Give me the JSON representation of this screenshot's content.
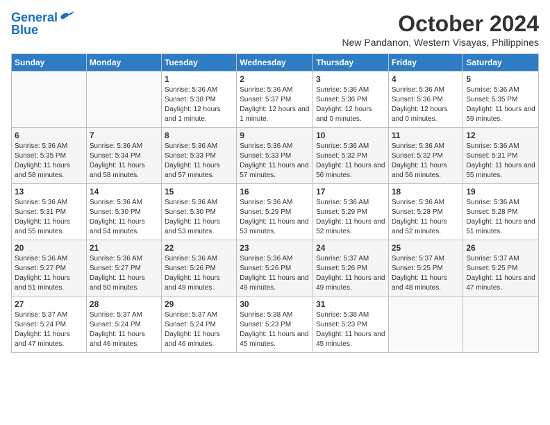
{
  "logo": {
    "line1": "General",
    "line2": "Blue"
  },
  "title": "October 2024",
  "location": "New Pandanon, Western Visayas, Philippines",
  "weekdays": [
    "Sunday",
    "Monday",
    "Tuesday",
    "Wednesday",
    "Thursday",
    "Friday",
    "Saturday"
  ],
  "weeks": [
    [
      {
        "day": "",
        "info": ""
      },
      {
        "day": "",
        "info": ""
      },
      {
        "day": "1",
        "info": "Sunrise: 5:36 AM\nSunset: 5:38 PM\nDaylight: 12 hours and 1 minute."
      },
      {
        "day": "2",
        "info": "Sunrise: 5:36 AM\nSunset: 5:37 PM\nDaylight: 12 hours and 1 minute."
      },
      {
        "day": "3",
        "info": "Sunrise: 5:36 AM\nSunset: 5:36 PM\nDaylight: 12 hours and 0 minutes."
      },
      {
        "day": "4",
        "info": "Sunrise: 5:36 AM\nSunset: 5:36 PM\nDaylight: 12 hours and 0 minutes."
      },
      {
        "day": "5",
        "info": "Sunrise: 5:36 AM\nSunset: 5:35 PM\nDaylight: 11 hours and 59 minutes."
      }
    ],
    [
      {
        "day": "6",
        "info": "Sunrise: 5:36 AM\nSunset: 5:35 PM\nDaylight: 11 hours and 58 minutes."
      },
      {
        "day": "7",
        "info": "Sunrise: 5:36 AM\nSunset: 5:34 PM\nDaylight: 11 hours and 58 minutes."
      },
      {
        "day": "8",
        "info": "Sunrise: 5:36 AM\nSunset: 5:33 PM\nDaylight: 11 hours and 57 minutes."
      },
      {
        "day": "9",
        "info": "Sunrise: 5:36 AM\nSunset: 5:33 PM\nDaylight: 11 hours and 57 minutes."
      },
      {
        "day": "10",
        "info": "Sunrise: 5:36 AM\nSunset: 5:32 PM\nDaylight: 11 hours and 56 minutes."
      },
      {
        "day": "11",
        "info": "Sunrise: 5:36 AM\nSunset: 5:32 PM\nDaylight: 11 hours and 56 minutes."
      },
      {
        "day": "12",
        "info": "Sunrise: 5:36 AM\nSunset: 5:31 PM\nDaylight: 11 hours and 55 minutes."
      }
    ],
    [
      {
        "day": "13",
        "info": "Sunrise: 5:36 AM\nSunset: 5:31 PM\nDaylight: 11 hours and 55 minutes."
      },
      {
        "day": "14",
        "info": "Sunrise: 5:36 AM\nSunset: 5:30 PM\nDaylight: 11 hours and 54 minutes."
      },
      {
        "day": "15",
        "info": "Sunrise: 5:36 AM\nSunset: 5:30 PM\nDaylight: 11 hours and 53 minutes."
      },
      {
        "day": "16",
        "info": "Sunrise: 5:36 AM\nSunset: 5:29 PM\nDaylight: 11 hours and 53 minutes."
      },
      {
        "day": "17",
        "info": "Sunrise: 5:36 AM\nSunset: 5:29 PM\nDaylight: 11 hours and 52 minutes."
      },
      {
        "day": "18",
        "info": "Sunrise: 5:36 AM\nSunset: 5:28 PM\nDaylight: 11 hours and 52 minutes."
      },
      {
        "day": "19",
        "info": "Sunrise: 5:36 AM\nSunset: 5:28 PM\nDaylight: 11 hours and 51 minutes."
      }
    ],
    [
      {
        "day": "20",
        "info": "Sunrise: 5:36 AM\nSunset: 5:27 PM\nDaylight: 11 hours and 51 minutes."
      },
      {
        "day": "21",
        "info": "Sunrise: 5:36 AM\nSunset: 5:27 PM\nDaylight: 11 hours and 50 minutes."
      },
      {
        "day": "22",
        "info": "Sunrise: 5:36 AM\nSunset: 5:26 PM\nDaylight: 11 hours and 49 minutes."
      },
      {
        "day": "23",
        "info": "Sunrise: 5:36 AM\nSunset: 5:26 PM\nDaylight: 11 hours and 49 minutes."
      },
      {
        "day": "24",
        "info": "Sunrise: 5:37 AM\nSunset: 5:26 PM\nDaylight: 11 hours and 49 minutes."
      },
      {
        "day": "25",
        "info": "Sunrise: 5:37 AM\nSunset: 5:25 PM\nDaylight: 11 hours and 48 minutes."
      },
      {
        "day": "26",
        "info": "Sunrise: 5:37 AM\nSunset: 5:25 PM\nDaylight: 11 hours and 47 minutes."
      }
    ],
    [
      {
        "day": "27",
        "info": "Sunrise: 5:37 AM\nSunset: 5:24 PM\nDaylight: 11 hours and 47 minutes."
      },
      {
        "day": "28",
        "info": "Sunrise: 5:37 AM\nSunset: 5:24 PM\nDaylight: 11 hours and 46 minutes."
      },
      {
        "day": "29",
        "info": "Sunrise: 5:37 AM\nSunset: 5:24 PM\nDaylight: 11 hours and 46 minutes."
      },
      {
        "day": "30",
        "info": "Sunrise: 5:38 AM\nSunset: 5:23 PM\nDaylight: 11 hours and 45 minutes."
      },
      {
        "day": "31",
        "info": "Sunrise: 5:38 AM\nSunset: 5:23 PM\nDaylight: 11 hours and 45 minutes."
      },
      {
        "day": "",
        "info": ""
      },
      {
        "day": "",
        "info": ""
      }
    ]
  ]
}
